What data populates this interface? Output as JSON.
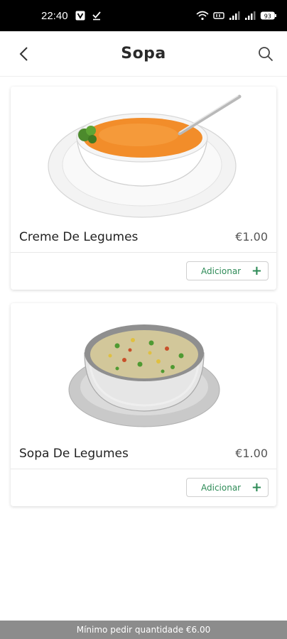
{
  "status_bar": {
    "time": "22:40",
    "battery": "93",
    "icons": [
      "v-app-icon",
      "download-done-icon",
      "wifi-icon",
      "volte-icon",
      "signal-icon",
      "signal-icon",
      "battery-icon"
    ]
  },
  "header": {
    "title": "Sopa",
    "back_icon": "back-arrow-icon",
    "search_icon": "search-icon"
  },
  "products": [
    {
      "name": "Creme De Legumes",
      "price": "€1.00",
      "add_label": "Adicionar",
      "add_icon": "plus-icon",
      "image": "cream-soup-bowl"
    },
    {
      "name": "Sopa De Legumes",
      "price": "€1.00",
      "add_label": "Adicionar",
      "add_icon": "plus-icon",
      "image": "vegetable-soup-bowl"
    }
  ],
  "footer": {
    "minimum_order": "Mínimo pedir quantidade €6.00"
  },
  "colors": {
    "accent_green": "#2e8b57",
    "footer_bg": "#8c8c8c",
    "status_bar_bg": "#000000"
  }
}
